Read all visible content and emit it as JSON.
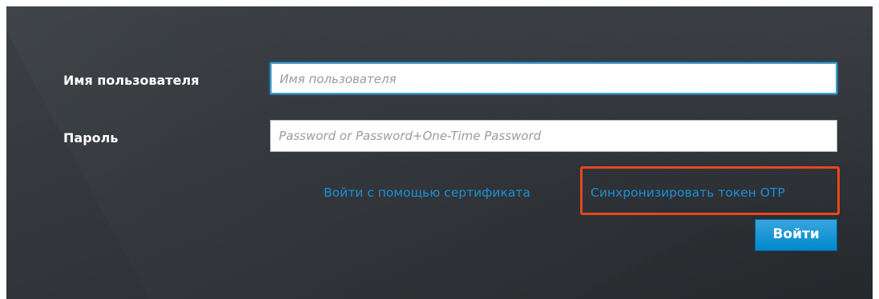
{
  "form": {
    "username_label": "Имя пользователя",
    "username_placeholder": "Имя пользователя",
    "password_label": "Пароль",
    "password_placeholder": "Password or Password+One-Time Password"
  },
  "links": {
    "cert_login": "Войти с помощью сертификата",
    "sync_otp": "Синхронизировать токен OTP"
  },
  "buttons": {
    "login": "Войти"
  },
  "colors": {
    "link": "#1b8fd6",
    "highlight": "#e8471e",
    "button": "#0088ce"
  }
}
